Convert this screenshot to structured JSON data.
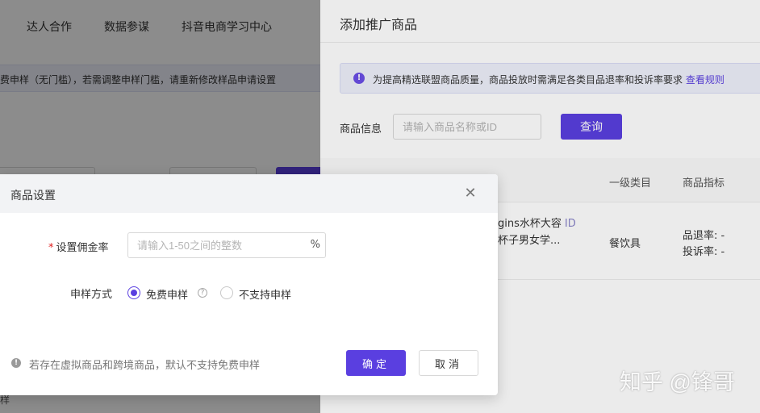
{
  "background_page": {
    "nav": [
      "达人合作",
      "数据参谋",
      "抖音电商学习中心"
    ],
    "notice_fragment": "费申样（无门槛），若需调整申样门槛，请重新修改样品申请设置",
    "bottom_fragment": "样"
  },
  "drawer": {
    "title": "添加推广商品",
    "notice": {
      "text": "为提高精选联盟商品质量，商品投放时需满足各类目品退率和投诉率要求 ",
      "link": "查看规则"
    },
    "search": {
      "label": "商品信息",
      "placeholder": "请输入商品名称或ID",
      "button": "查询"
    },
    "table": {
      "headers": {
        "category": "一级类目",
        "metrics": "商品指标"
      },
      "rows": [
        {
          "name_line1": "gins水杯大容",
          "id_badge": "ID",
          "name_line2": "杯子男女学...",
          "category": "餐饮具",
          "return_rate": "品退率: -",
          "complaint_rate": "投诉率: -"
        }
      ]
    }
  },
  "modal": {
    "title": "商品设置",
    "commission": {
      "required_mark": "*",
      "label": "设置佣金率",
      "placeholder": "请输入1-50之间的整数",
      "suffix": "%"
    },
    "sample": {
      "label": "申样方式",
      "options": [
        {
          "label": "免费申样",
          "selected": true
        },
        {
          "label": "不支持申样",
          "selected": false
        }
      ]
    },
    "footer_note": "若存在虚拟商品和跨境商品，默认不支持免费申样",
    "confirm": "确定",
    "cancel": "取消"
  },
  "watermark": "知乎 @锋哥",
  "colors": {
    "accent": "#5a3fe0",
    "notice_bg": "#eef0fb",
    "required": "#e02020"
  },
  "icons": {
    "notice": "exclamation-circle-icon",
    "close": "close-icon",
    "help": "question-circle-icon",
    "footer": "exclamation-circle-icon"
  }
}
